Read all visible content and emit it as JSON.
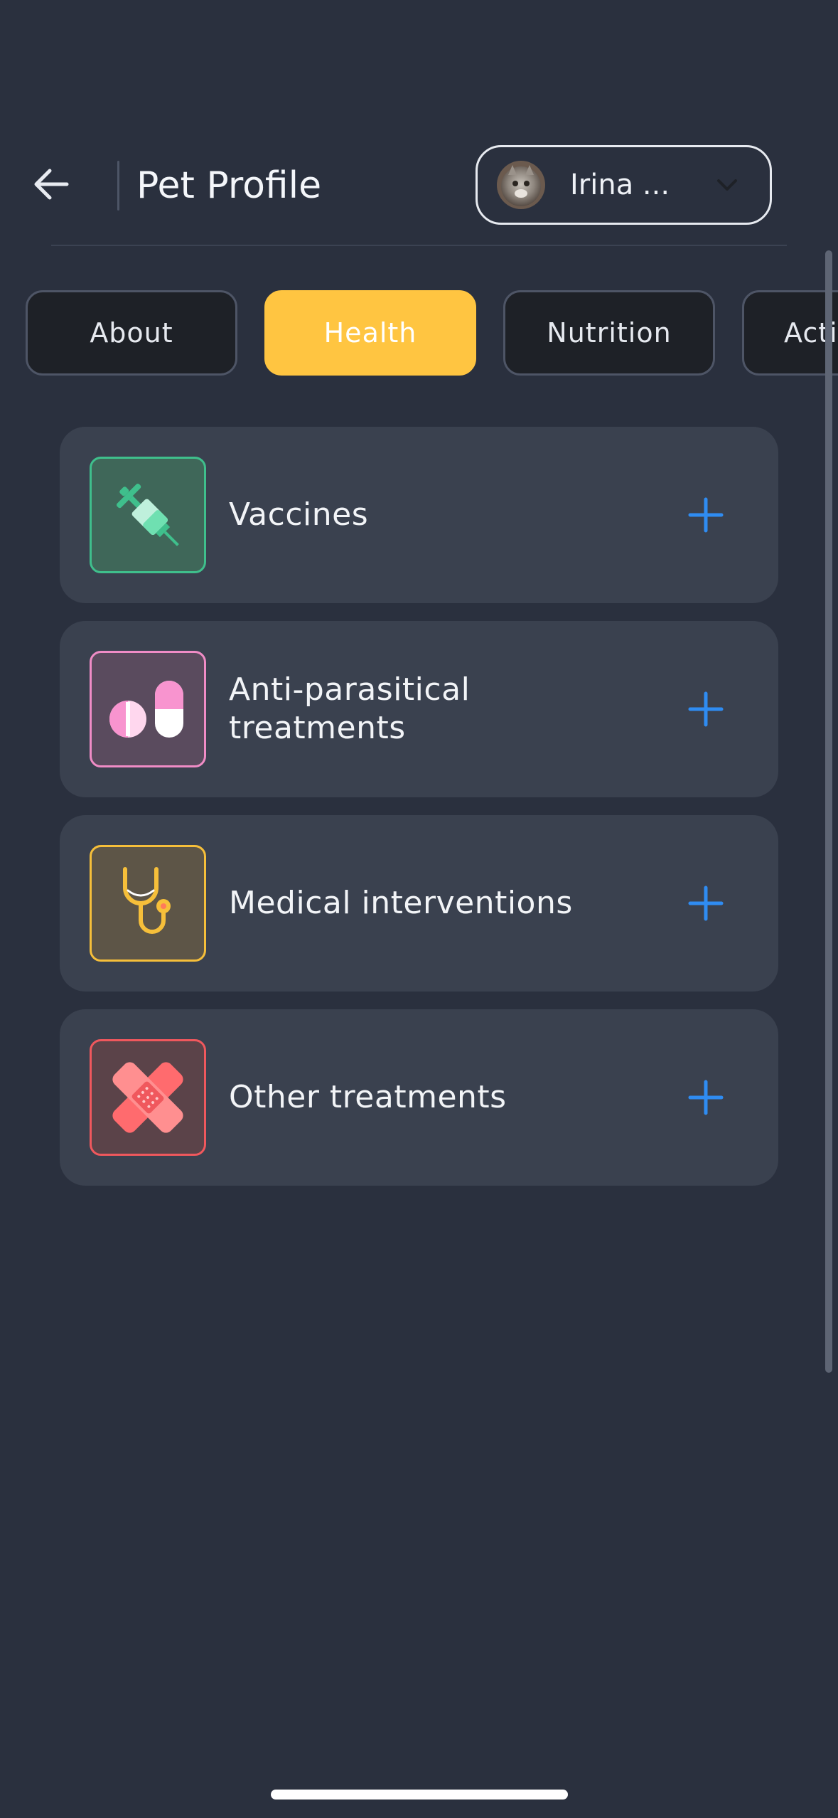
{
  "header": {
    "title": "Pet Profile",
    "profile_name": "Irina ..."
  },
  "tabs": [
    {
      "label": "About",
      "active": false
    },
    {
      "label": "Health",
      "active": true
    },
    {
      "label": "Nutrition",
      "active": false
    },
    {
      "label": "Acti",
      "active": false
    }
  ],
  "sections": [
    {
      "label": "Vaccines",
      "icon": "syringe-icon",
      "accent": "#3fbf8c"
    },
    {
      "label": "Anti-parasitical treatments",
      "icon": "pills-icon",
      "accent": "#f08cc6"
    },
    {
      "label": "Medical interventions",
      "icon": "stethoscope-icon",
      "accent": "#f6bf3a"
    },
    {
      "label": "Other treatments",
      "icon": "bandage-icon",
      "accent": "#f0585d"
    }
  ],
  "colors": {
    "background": "#2a303e",
    "card": "#3a414f",
    "active_tab": "#ffc541",
    "plus": "#2f8cf2"
  }
}
